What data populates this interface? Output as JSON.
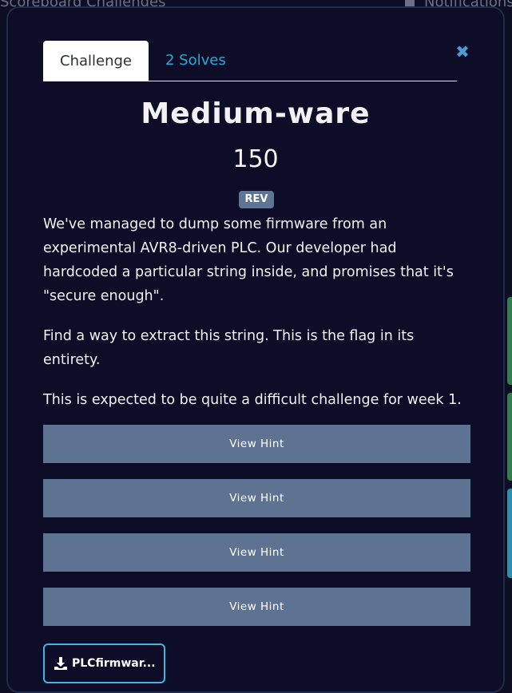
{
  "background": {
    "left_text": "Scoreboard    Challenges",
    "right_text": "Notifications"
  },
  "modal": {
    "tabs": [
      {
        "label": "Challenge",
        "active": true
      },
      {
        "label": "2 Solves",
        "active": false
      }
    ],
    "close_icon": "close-icon",
    "title": "Medium-ware",
    "points": "150",
    "tag": "REV",
    "description": [
      "We've managed to dump some firmware from an experimental AVR8-driven PLC. Our developer had hardcoded a particular string inside, and promises that it's \"secure enough\".",
      "Find a way to extract this string. This is the flag in its entirety.",
      "This is expected to be quite a difficult challenge for week 1."
    ],
    "hints": [
      "View Hint",
      "View Hint",
      "View Hint",
      "View Hint"
    ],
    "file": {
      "label": "PLCfirmwar...",
      "icon": "download-icon"
    }
  },
  "colors": {
    "modal_bg": "#0d0d28",
    "hint_button": "#5e7392",
    "tag": "#5d7494",
    "accent": "#37b8e6",
    "tab_link": "#2aa8d8"
  }
}
